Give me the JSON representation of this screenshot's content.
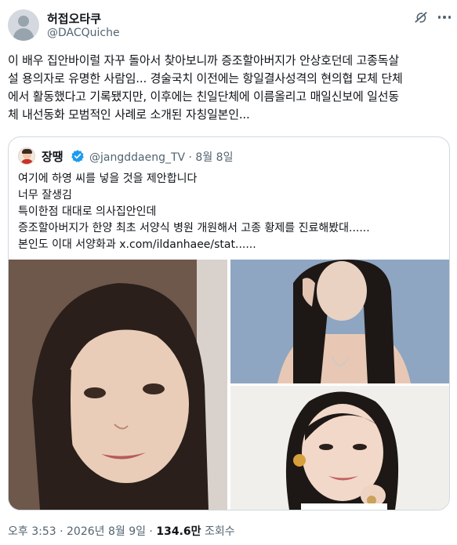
{
  "author": {
    "name": "허접오타쿠",
    "handle": "@DACQuiche"
  },
  "tweet": {
    "lines": [
      "이 배우 집안바이럴 자꾸 돌아서 찾아보니까 증조할아버지가 안상호던데 고종독살",
      "설 용의자로 유명한 사람임... 경술국치 이전에는 항일결사성격의 현의협 모체 단체",
      "에서 활동했다고 기록됐지만, 이후에는 친일단체에 이름올리고 매일신보에 일선동",
      "체 내선동화 모범적인 사례로 소개된 자칭일본인..."
    ]
  },
  "quote": {
    "name": "장땡",
    "handle_date": "@jangddaeng_TV · 8월 8일",
    "lines": [
      "여기에 하영 씨를 넣을 것을 제안합니다",
      "너무 잘생김",
      "특이한점 대대로 의사집안인데",
      "증조할아버지가 한양 최초 서양식 병원 개원해서 고종 황제를 진료해봤대......",
      "본인도 이대 서양화과  x.com/ildanhaee/stat......"
    ],
    "images": [
      "photo-portrait",
      "photo-pose",
      "photo-smile"
    ]
  },
  "footer": {
    "time": "오후 3:53 · 2026년 8월 9일 · ",
    "views": "134.6만",
    "views_label": " 조회수"
  },
  "colors": {
    "text": "#0f1419",
    "secondary": "#536471",
    "border": "#cfd9de",
    "verified": "#1d9bf0"
  }
}
